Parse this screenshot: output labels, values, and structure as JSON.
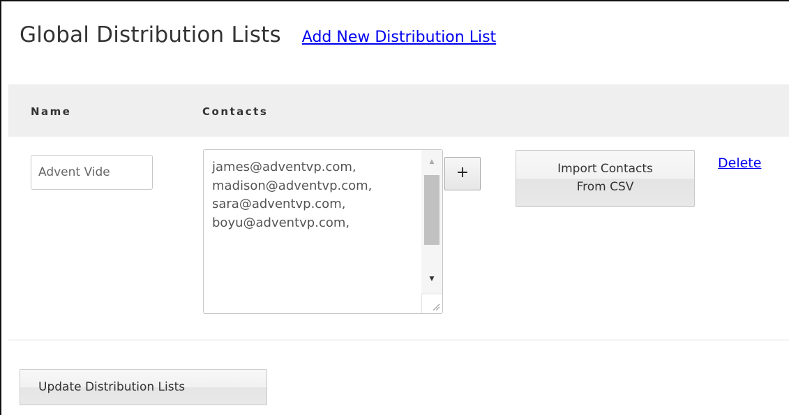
{
  "header": {
    "title": "Global Distribution Lists",
    "add_link": "Add New Distribution List"
  },
  "table": {
    "columns": [
      "Name",
      "Contacts"
    ],
    "rows": [
      {
        "name_value": "Advent Vide",
        "contacts_value": "james@adventvp.com,\nmadison@adventvp.com,\nsara@adventvp.com,\nboyu@adventvp.com,",
        "add_contact_label": "+",
        "import_label_line1": "Import Contacts",
        "import_label_line2": "From CSV",
        "delete_label": "Delete"
      }
    ]
  },
  "footer": {
    "update_label": "Update Distribution Lists"
  },
  "colors": {
    "link": "#0000ee",
    "header_bg": "#efefef",
    "text": "#333333"
  }
}
